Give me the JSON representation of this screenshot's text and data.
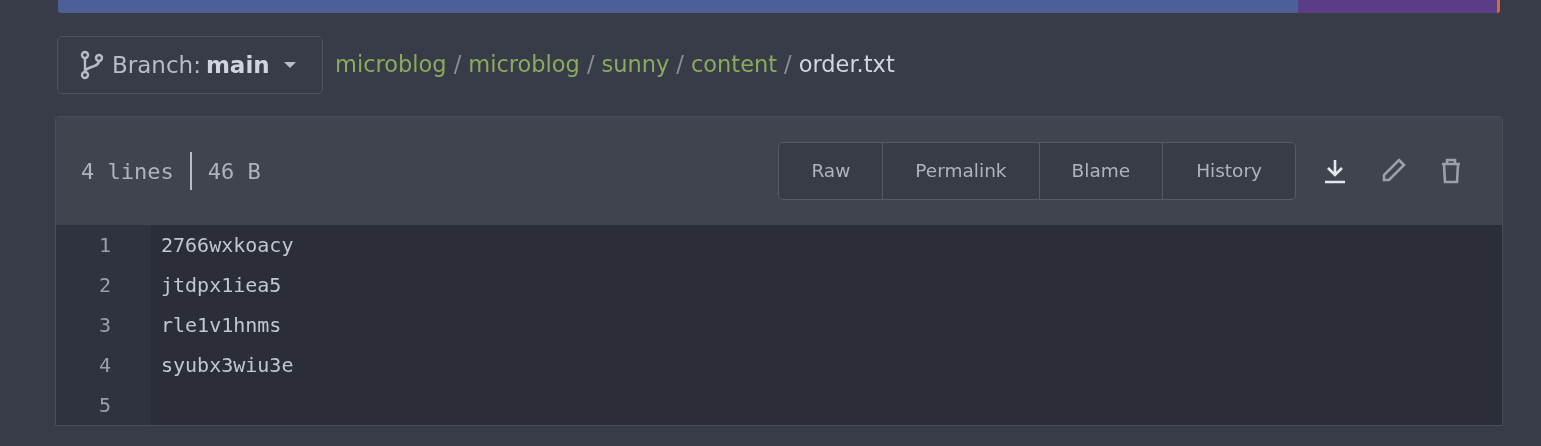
{
  "language_bar": [
    {
      "color": "#4c5f97"
    },
    {
      "color": "#5b3d87"
    },
    {
      "color": "#e0662f"
    }
  ],
  "branch": {
    "label": "Branch:",
    "name": "main"
  },
  "breadcrumb": [
    {
      "text": "microblog",
      "kind": "link"
    },
    {
      "text": "/",
      "kind": "separator"
    },
    {
      "text": "microblog",
      "kind": "link"
    },
    {
      "text": "/",
      "kind": "separator"
    },
    {
      "text": "sunny",
      "kind": "link"
    },
    {
      "text": "/",
      "kind": "separator"
    },
    {
      "text": "content",
      "kind": "link"
    },
    {
      "text": "/",
      "kind": "separator"
    },
    {
      "text": "order.txt",
      "kind": "current"
    }
  ],
  "file_info": {
    "lines": "4 lines",
    "size": "46 B"
  },
  "actions": [
    "Raw",
    "Permalink",
    "Blame",
    "History"
  ],
  "tools": [
    {
      "kind": "download",
      "highlighted": true
    },
    {
      "kind": "edit",
      "highlighted": false
    },
    {
      "kind": "delete",
      "highlighted": false
    }
  ],
  "code_lines": [
    {
      "number": "1",
      "text": "2766wxkoacy"
    },
    {
      "number": "2",
      "text": "jtdpx1iea5"
    },
    {
      "number": "3",
      "text": "rle1v1hnms"
    },
    {
      "number": "4",
      "text": "syubx3wiu3e"
    },
    {
      "number": "5"
    }
  ]
}
